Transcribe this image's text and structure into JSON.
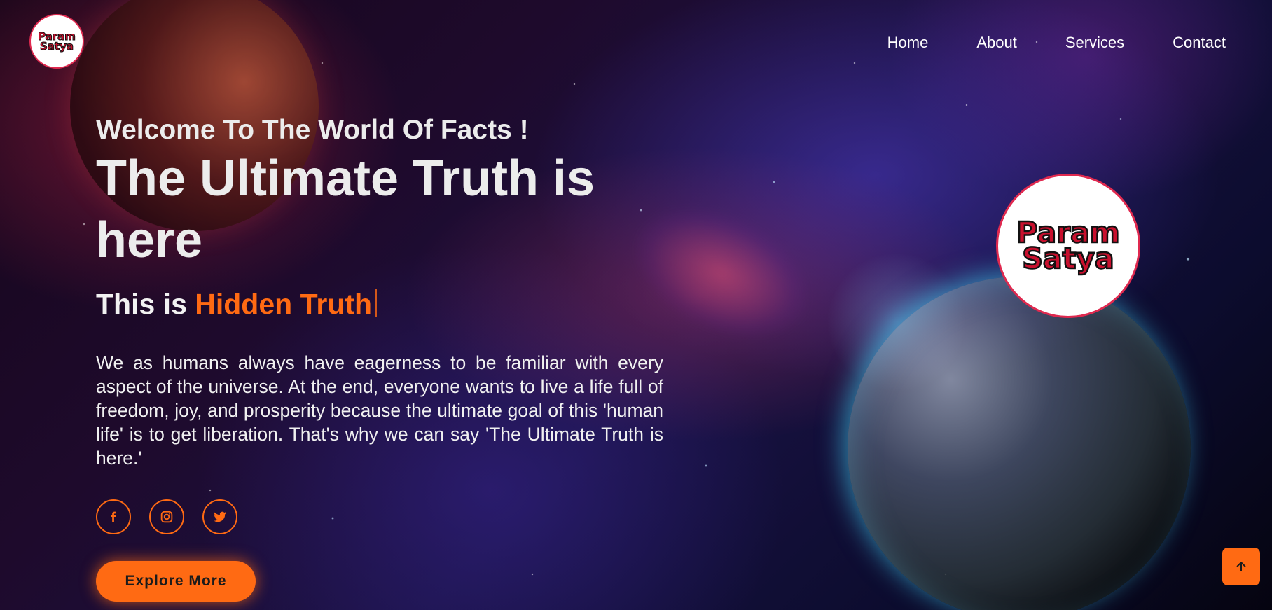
{
  "brand": {
    "logo_line1": "Param",
    "logo_line2": "Satya",
    "accent_color": "#ff6a13",
    "ring_color": "#e0294f"
  },
  "nav": {
    "items": [
      {
        "label": "Home"
      },
      {
        "label": "About"
      },
      {
        "label": "Services"
      },
      {
        "label": "Contact"
      }
    ]
  },
  "hero": {
    "welcome": "Welcome To The World Of Facts !",
    "headline": "The Ultimate Truth is here",
    "subline_prefix": "This is ",
    "subline_highlight": "Hidden Truth",
    "description": "We as humans always have eagerness to be familiar with every aspect of the universe. At the end, everyone wants to live a life full of freedom, joy, and prosperity because the ultimate goal of this 'human life' is to get liberation. That's why we can say 'The Ultimate Truth is here.'",
    "cta_label": "Explore More"
  },
  "socials": [
    {
      "icon": "facebook-icon"
    },
    {
      "icon": "instagram-icon"
    },
    {
      "icon": "twitter-icon"
    }
  ],
  "scroll_top": {
    "icon": "arrow-up-icon"
  }
}
